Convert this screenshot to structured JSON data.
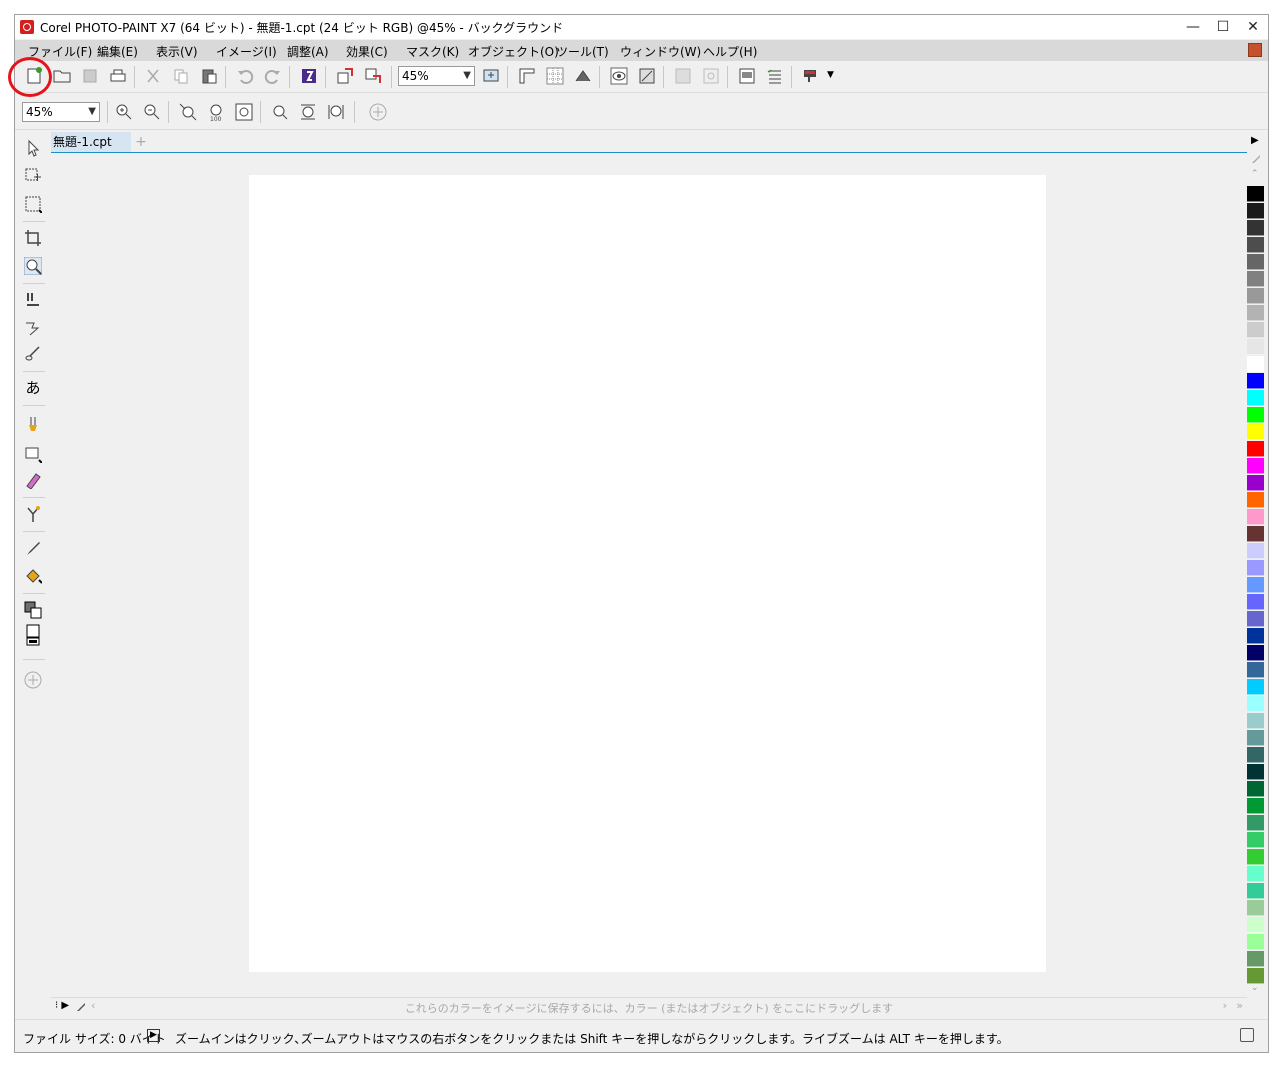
{
  "window": {
    "title": "Corel PHOTO-PAINT X7 (64 ビット) - 無題-1.cpt (24 ビット RGB) @45% - バックグラウンド",
    "controls": {
      "minimize": "—",
      "maximize": "☐",
      "close": "✕"
    }
  },
  "menubar": {
    "items": [
      "ファイル(F)",
      "編集(E)",
      "表示(V)",
      "イメージ(I)",
      "調整(A)",
      "効果(C)",
      "マスク(K)",
      "オブジェクト(O)",
      "ツール(T)",
      "ウィンドウ(W)",
      "ヘルプ(H)"
    ]
  },
  "toolbar": {
    "zoom_value": "45%",
    "icons": [
      "new-document",
      "open",
      "save",
      "print",
      "cut",
      "copy",
      "paste",
      "undo",
      "redo",
      "corel-launcher",
      "import",
      "export",
      "full-screen-preview",
      "rulers",
      "grid",
      "guidelines",
      "show-objects",
      "show-masks",
      "lens",
      "mask-overlay",
      "docker",
      "object-manager",
      "application-launcher"
    ]
  },
  "zoom_toolbar": {
    "zoom_value": "45%",
    "icons": [
      "zoom-in",
      "zoom-out",
      "zoom-100",
      "zoom-to-fit",
      "zoom-to-width",
      "zoom-to-height",
      "zoom-to-page",
      "zoom-actual",
      "add"
    ]
  },
  "document_tabs": {
    "active": "無題-1.cpt",
    "add_label": "+"
  },
  "toolbox": {
    "tools": [
      "pick",
      "transform",
      "mask-rectangle",
      "crop",
      "zoom",
      "clone",
      "touch-up-brush",
      "paint",
      "text",
      "effect",
      "rectangle",
      "eraser",
      "color-replacer",
      "eyedropper",
      "fill",
      "color-swatches",
      "add"
    ]
  },
  "palette": {
    "colors": [
      "#000000",
      "#1a1a1a",
      "#333333",
      "#4d4d4d",
      "#666666",
      "#808080",
      "#999999",
      "#b3b3b3",
      "#cccccc",
      "#e6e6e6",
      "#ffffff",
      "#0000ff",
      "#00ffff",
      "#00ff00",
      "#ffff00",
      "#ff0000",
      "#ff00ff",
      "#9900cc",
      "#ff6600",
      "#ff99cc",
      "#663333",
      "#ccccff",
      "#9999ff",
      "#6699ff",
      "#6666ff",
      "#6666cc",
      "#003399",
      "#000066",
      "#336699",
      "#00ccff",
      "#99ffff",
      "#99cccc",
      "#669999",
      "#336666",
      "#003333",
      "#006633",
      "#009933",
      "#339966",
      "#33cc66",
      "#33cc33",
      "#66ffcc",
      "#33cc99",
      "#99cc99",
      "#ccffcc",
      "#99ff99",
      "#669966",
      "#669933"
    ]
  },
  "bottom_palette": {
    "hint": "これらのカラーをイメージに保存するには、カラー (またはオブジェクト) をここにドラッグします"
  },
  "statusbar": {
    "file_size": "ファイル サイズ: 0 バイト",
    "message": "ズームインはクリック､ズームアウトはマウスの右ボタンをクリックまたは Shift キーを押しながらクリックします。ライブズームは ALT キーを押します。"
  }
}
